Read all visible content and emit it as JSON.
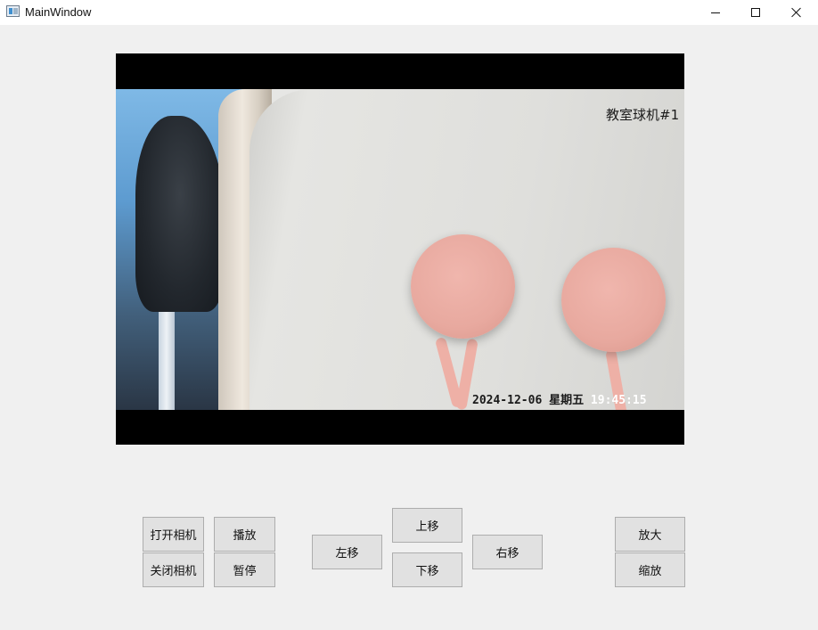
{
  "window": {
    "title": "MainWindow"
  },
  "video": {
    "channel_label": "教室球机#1",
    "date_weekday": "2024-12-06 星期五 ",
    "time": "19:45:15"
  },
  "buttons": {
    "open_camera": "打开相机",
    "close_camera": "关闭相机",
    "play": "播放",
    "pause": "暂停",
    "move_left": "左移",
    "move_up": "上移",
    "move_down": "下移",
    "move_right": "右移",
    "zoom_in": "放大",
    "zoom_out": "缩放"
  }
}
